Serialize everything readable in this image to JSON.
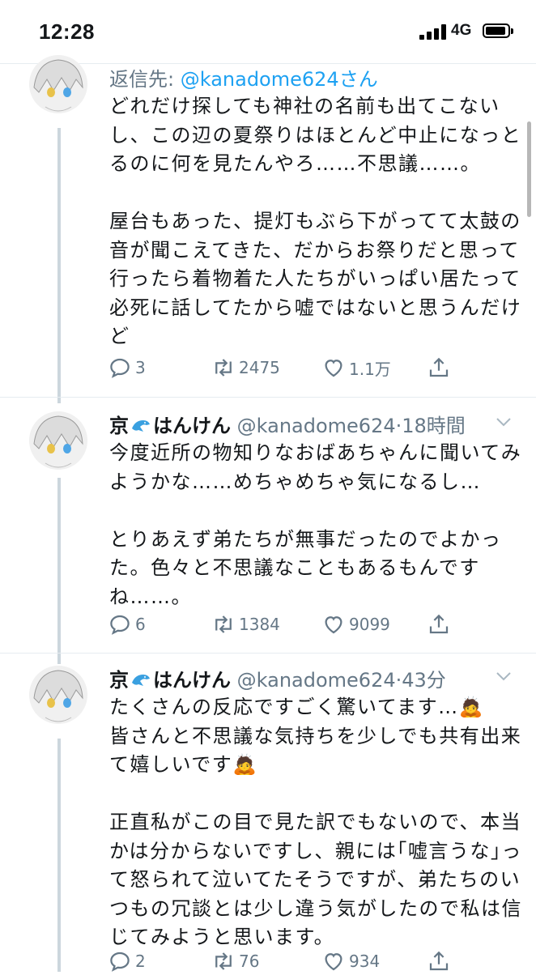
{
  "status_bar": {
    "time": "12:28",
    "network": "4G"
  },
  "tweets": [
    {
      "reply_label": "返信先: ",
      "reply_handle": "@kanadome624さん",
      "text": "どれだけ探しても神社の名前も出てこない\nし、この辺の夏祭りはほとんど中止になっと\nるのに何を見たんやろ……不思議……。\n\n屋台もあった、提灯もぶら下がってて太鼓の\n音が聞こえてきた、だからお祭りだと思って\n行ったら着物着た人たちがいっぱい居たって\n必死に話してたから嘘ではないと思うんだけ\nど",
      "replies": "3",
      "retweets": "2475",
      "likes": "1.1万"
    },
    {
      "name_a": "京",
      "name_b": "はんけん",
      "meta": "@kanadome624·18時間",
      "text": "今度近所の物知りなおばあちゃんに聞いてみ\nようかな……めちゃめちゃ気になるし…\n\nとりあえず弟たちが無事だったのでよかっ\nた。色々と不思議なこともあるもんです\nね……。",
      "replies": "6",
      "retweets": "1384",
      "likes": "9099"
    },
    {
      "name_a": "京",
      "name_b": "はんけん",
      "meta": "@kanadome624·43分",
      "text": "たくさんの反応ですごく驚いてます…🙇\n皆さんと不思議な気持ちを少しでも共有出来\nて嬉しいです🙇\n\n正直私がこの目で見た訳でもないので、本当\nかは分からないですし、親には｢嘘言うな｣っ\nて怒られて泣いてたそうですが、弟たちのい\nつもの冗談とは少し違う気がしたので私は信\nじてみようと思います。",
      "replies": "2",
      "retweets": "76",
      "likes": "934"
    }
  ],
  "icons": {
    "reply": "reply-icon",
    "retweet": "retweet-icon",
    "like": "like-icon",
    "share": "share-icon",
    "dolphin": "dolphin-emoji",
    "caret": "chevron-down-icon"
  },
  "colors": {
    "link": "#1da1f2",
    "meta": "#657786",
    "thread_line": "#ccd6dd",
    "text": "#14171a"
  }
}
